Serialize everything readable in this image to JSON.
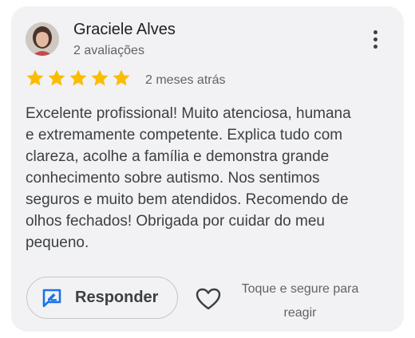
{
  "review": {
    "author_name": "Graciele Alves",
    "author_reviews": "2 avaliações",
    "rating": 5,
    "rating_max": 5,
    "time_ago": "2 meses atrás",
    "text": "Excelente profissional! Muito atenciosa, humana\ne extremamente competente. Explica tudo com\nclareza, acolhe a família e demonstra grande\nconhecimento sobre autismo. Nos sentimos\nseguros e muito bem atendidos. Recomendo de\nolhos fechados! Obrigada por cuidar do meu\npequeno."
  },
  "actions": {
    "reply_label": "Responder",
    "react_hint": "Toque e segure para reagir"
  },
  "icons": {
    "menu": "more-vert-icon",
    "star": "star-icon",
    "reply": "reply-edit-icon",
    "heart": "heart-outline-icon"
  },
  "colors": {
    "star": "#fbbc04",
    "reply_icon": "#1a73e8",
    "card_background": "#f2f2f4"
  }
}
